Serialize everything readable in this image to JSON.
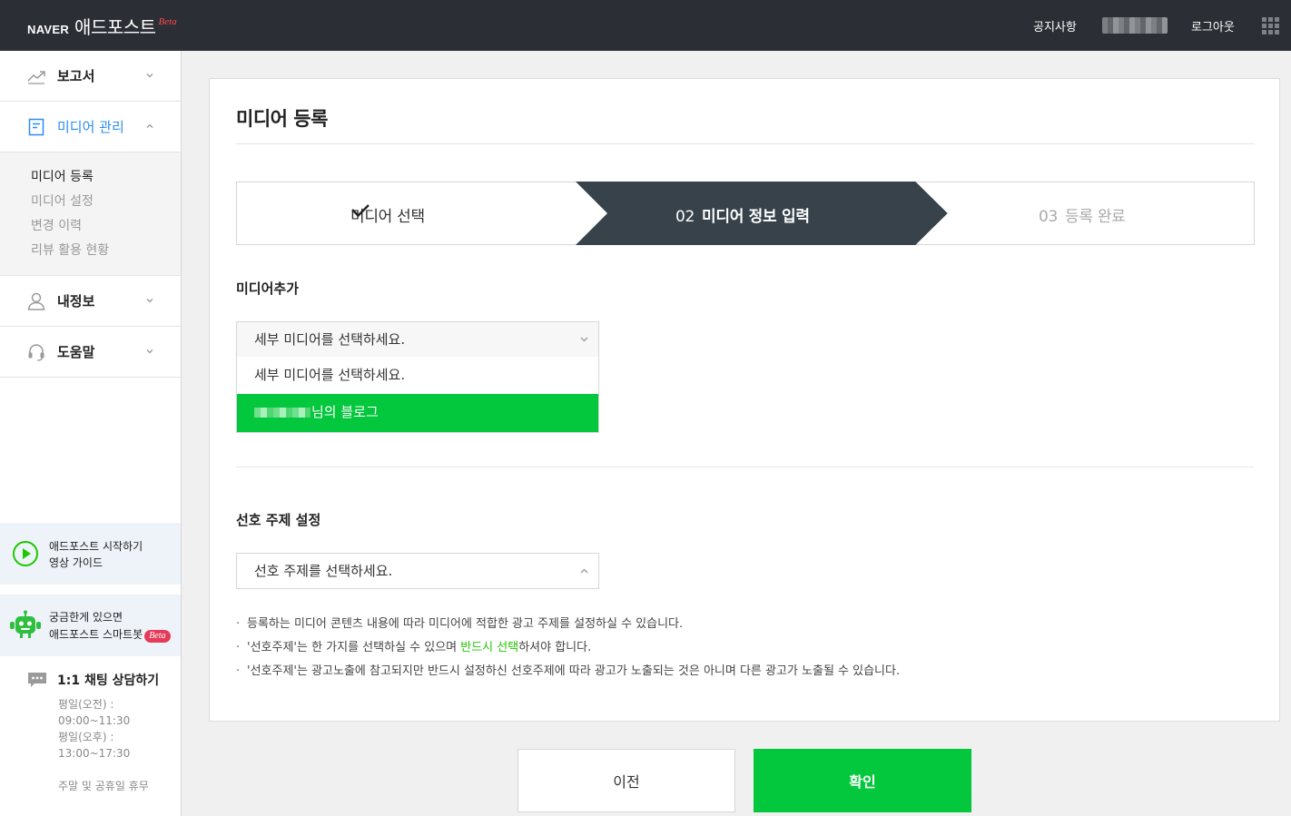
{
  "header": {
    "brand": "NAVER",
    "product": "애드포스트",
    "beta": "Beta",
    "notice_label": "공지사항",
    "logout_label": "로그아웃"
  },
  "sidebar": {
    "items": [
      {
        "label": "보고서",
        "icon": "chart-icon"
      },
      {
        "label": "미디어 관리",
        "icon": "document-icon"
      },
      {
        "label": "내정보",
        "icon": "person-icon"
      },
      {
        "label": "도움말",
        "icon": "headset-icon"
      }
    ],
    "subitems": [
      "미디어 등록",
      "미디어 설정",
      "변경 이력",
      "리뷰 활용 현황"
    ],
    "guide": {
      "line1": "애드포스트 시작하기",
      "line2": "영상 가이드"
    },
    "smartbot": {
      "line1": "궁금한게 있으면",
      "line2": "애드포스트 스마트봇",
      "beta": "Beta"
    },
    "chat": {
      "title": "1:1 채팅 상담하기",
      "hours": [
        "평일(오전) :",
        "09:00~11:30",
        "평일(오후) :",
        "13:00~17:30",
        "",
        "주말 및 공휴일 휴무"
      ]
    }
  },
  "main": {
    "title": "미디어 등록",
    "steps": [
      {
        "num": "",
        "label": "미디어 선택",
        "state": "done"
      },
      {
        "num": "02",
        "label": "미디어 정보 입력",
        "state": "current"
      },
      {
        "num": "03",
        "label": "등록 완료",
        "state": "pending"
      }
    ],
    "media_section": {
      "label": "미디어추가",
      "placeholder": "세부 미디어를 선택하세요.",
      "options": [
        "세부 미디어를 선택하세요.",
        "님의 블로그"
      ]
    },
    "topic_section": {
      "label": "선호 주제 설정",
      "placeholder": "선호 주제를 선택하세요."
    },
    "notes": [
      {
        "pre": "등록하는 미디어 콘텐츠 내용에 따라 미디어에 적합한 광고 주제를 설정하실 수 있습니다.",
        "em": "",
        "post": ""
      },
      {
        "pre": "'선호주제'는 한 가지를 선택하실 수 있으며 ",
        "em": "반드시 선택",
        "post": "하셔야 합니다."
      },
      {
        "pre": "'선호주제'는 광고노출에 참고되지만 반드시 설정하신 선호주제에 따라 광고가 노출되는 것은 아니며 다른 광고가 노출될 수 있습니다.",
        "em": "",
        "post": ""
      }
    ]
  },
  "buttons": {
    "prev": "이전",
    "confirm": "확인"
  },
  "colors": {
    "accent_green": "#03c73c",
    "topbar": "#2b2e34",
    "step_active": "#37424b",
    "link_blue": "#2d8cf0"
  }
}
